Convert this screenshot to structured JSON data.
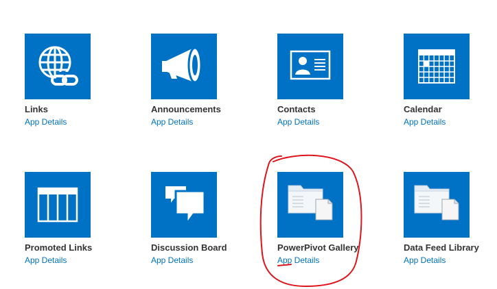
{
  "theme": {
    "tile_color": "#0072c6",
    "link_color": "#0072c6",
    "title_color": "#333333",
    "annotation_color": "#e0141b"
  },
  "apps": [
    {
      "title": "Links",
      "details_label": "App Details",
      "icon": "globe-link-icon"
    },
    {
      "title": "Announcements",
      "details_label": "App Details",
      "icon": "megaphone-icon"
    },
    {
      "title": "Contacts",
      "details_label": "App Details",
      "icon": "contact-card-icon"
    },
    {
      "title": "Calendar",
      "details_label": "App Details",
      "icon": "calendar-icon"
    },
    {
      "title": "Promoted Links",
      "details_label": "App Details",
      "icon": "promoted-links-icon"
    },
    {
      "title": "Discussion Board",
      "details_label": "App Details",
      "icon": "speech-bubbles-icon"
    },
    {
      "title": "PowerPivot Gallery",
      "details_label": "App Details",
      "icon": "folder-document-icon"
    },
    {
      "title": "Data Feed Library",
      "details_label": "App Details",
      "icon": "folder-document-icon"
    }
  ]
}
